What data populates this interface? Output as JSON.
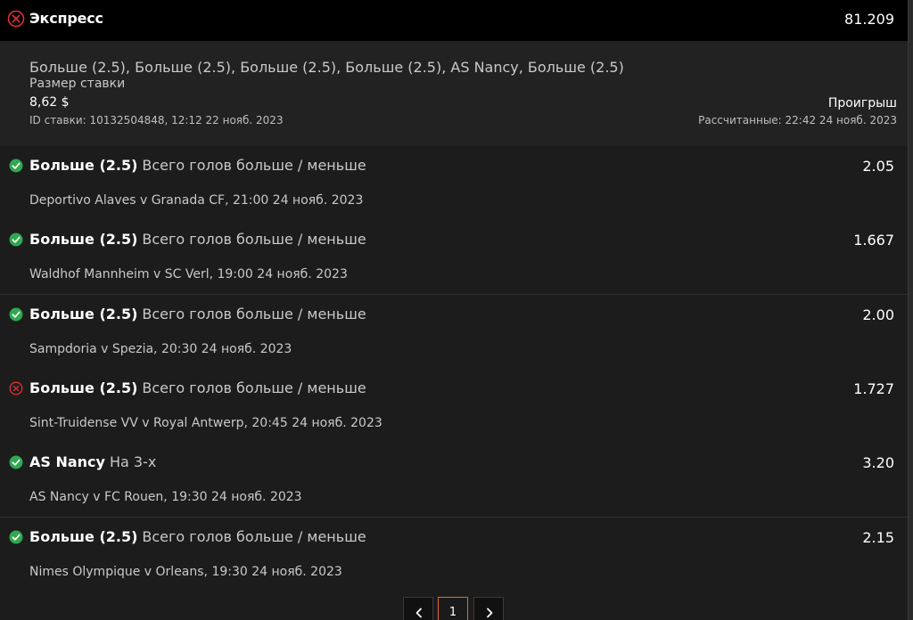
{
  "header": {
    "title": "Экспресс",
    "total_odds": "81.209",
    "status_icon": "lost-x-icon"
  },
  "summary": {
    "selections": "Больше (2.5), Больше (2.5), Больше (2.5), Больше (2.5), AS Nancy, Больше (2.5)",
    "stake_label": "Размер ставки",
    "stake_value": "8,62 $",
    "bet_id": "ID ставки: 10132504848, 12:12 22 нояб. 2023",
    "result": "Проигрыш",
    "settled": "Рассчитанные: 22:42 24 нояб. 2023"
  },
  "legs": [
    {
      "status": "won",
      "selection": "Больше (2.5)",
      "market": "Всего голов больше / меньше",
      "odds": "2.05",
      "event": "Deportivo Alaves v Granada CF, 21:00 24 нояб. 2023"
    },
    {
      "status": "won",
      "selection": "Больше (2.5)",
      "market": "Всего голов больше / меньше",
      "odds": "1.667",
      "event": "Waldhof Mannheim v SC Verl, 19:00 24 нояб. 2023"
    },
    {
      "status": "won",
      "selection": "Больше (2.5)",
      "market": "Всего голов больше / меньше",
      "odds": "2.00",
      "event": "Sampdoria v Spezia, 20:30 24 нояб. 2023"
    },
    {
      "status": "lost",
      "selection": "Больше (2.5)",
      "market": "Всего голов больше / меньше",
      "odds": "1.727",
      "event": "Sint-Truidense VV v Royal Antwerp, 20:45 24 нояб. 2023"
    },
    {
      "status": "won",
      "selection": "AS Nancy",
      "market": "На 3-х",
      "odds": "3.20",
      "event": "AS Nancy v FC Rouen, 19:30 24 нояб. 2023"
    },
    {
      "status": "won",
      "selection": "Больше (2.5)",
      "market": "Всего голов больше / меньше",
      "odds": "2.15",
      "event": "Nimes Olympique v Orleans, 19:30 24 нояб. 2023"
    }
  ],
  "pagination": {
    "current_page": "1"
  },
  "colors": {
    "won": "#2fa84f",
    "lost": "#e0322f",
    "accent": "#e2682a"
  }
}
